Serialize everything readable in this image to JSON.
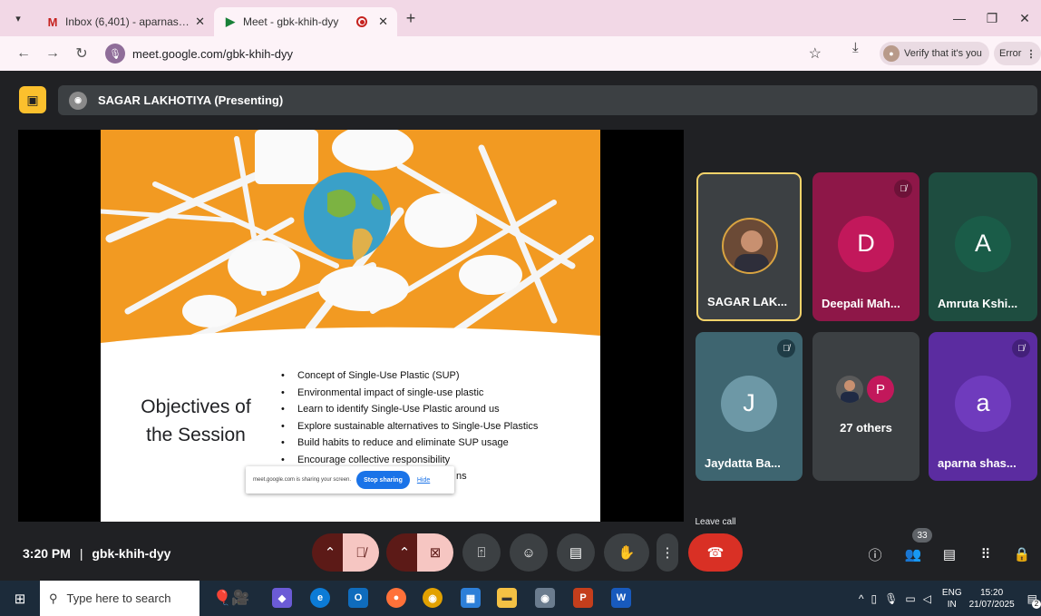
{
  "browser": {
    "tabs": [
      {
        "title": "Inbox (6,401) - aparnashastri@...",
        "favicon": "gmail-icon",
        "active": false
      },
      {
        "title": "Meet - gbk-khih-dyy",
        "favicon": "meet-icon",
        "active": true
      }
    ],
    "url": "meet.google.com/gbk-khih-dyy",
    "verify_label": "Verify that it's you",
    "error_label": "Error"
  },
  "meet": {
    "presenter_label": "SAGAR LAKHOTIYA (Presenting)",
    "slide": {
      "title_line1": "Objectives of",
      "title_line2": "the Session",
      "bullets": [
        "Concept of Single-Use Plastic (SUP)",
        "Environmental impact of single-use plastic",
        "Learn to identify Single-Use Plastic around us",
        "Explore sustainable alternatives to Single-Use Plastics",
        "Build habits to reduce and eliminate SUP usage",
        "Encourage collective responsibility"
      ],
      "partial_text": "ns"
    },
    "share_bar": {
      "message": "meet.google.com is sharing your screen.",
      "stop_label": "Stop sharing",
      "hide_label": "Hide"
    },
    "participants": [
      {
        "name": "SAGAR LAK...",
        "initial": "",
        "color": "#3c4043",
        "muted": false,
        "active_speaker": true
      },
      {
        "name": "Deepali Mah...",
        "initial": "D",
        "color": "#c2185b",
        "muted": true
      },
      {
        "name": "Amruta Kshi...",
        "initial": "A",
        "color": "#1e5b4b",
        "muted": false
      },
      {
        "name": "Jaydatta Ba...",
        "initial": "J",
        "color": "#5f8a9a",
        "muted": true
      },
      {
        "name": "27 others",
        "initial": "P",
        "color": "#3c4043",
        "muted": false
      },
      {
        "name": "aparna shas...",
        "initial": "a",
        "color": "#5b2ca0",
        "muted": true
      }
    ],
    "clock": "3:20 PM",
    "separator": "|",
    "meeting_code": "gbk-khih-dyy",
    "leave_tooltip": "Leave call",
    "people_count": "33"
  },
  "taskbar": {
    "search_placeholder": "Type here to search",
    "lang_line1": "ENG",
    "lang_line2": "IN",
    "time": "15:20",
    "date": "21/07/2025",
    "notif_count": "2"
  }
}
